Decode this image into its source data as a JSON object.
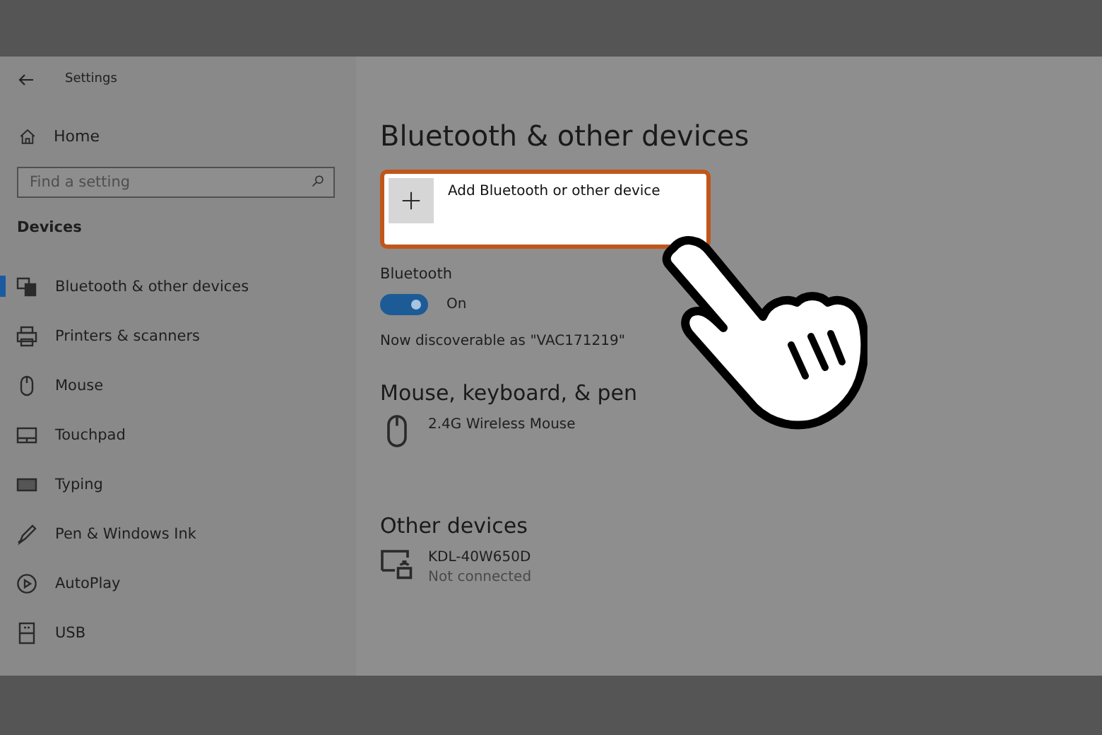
{
  "window": {
    "title": "Settings"
  },
  "sidebar": {
    "home": "Home",
    "search": {
      "placeholder": "Find a setting"
    },
    "section": "Devices",
    "items": [
      {
        "kind": "bluetooth",
        "label": "Bluetooth & other devices",
        "selected": true
      },
      {
        "kind": "printer",
        "label": "Printers & scanners",
        "selected": false
      },
      {
        "kind": "mouse",
        "label": "Mouse",
        "selected": false
      },
      {
        "kind": "touchpad",
        "label": "Touchpad",
        "selected": false
      },
      {
        "kind": "typing",
        "label": "Typing",
        "selected": false
      },
      {
        "kind": "pen",
        "label": "Pen & Windows Ink",
        "selected": false
      },
      {
        "kind": "autoplay",
        "label": "AutoPlay",
        "selected": false
      },
      {
        "kind": "usb",
        "label": "USB",
        "selected": false
      }
    ]
  },
  "main": {
    "title": "Bluetooth & other devices",
    "add_button": "Add Bluetooth or other device",
    "bluetooth": {
      "label": "Bluetooth",
      "on": true,
      "state_text": "On"
    },
    "discoverable": "Now discoverable as \"VAC171219\"",
    "sections": [
      {
        "heading": "Mouse, keyboard, & pen",
        "devices": [
          {
            "kind": "mouse",
            "name": "2.4G Wireless Mouse"
          }
        ]
      },
      {
        "heading": "Other devices",
        "devices": [
          {
            "kind": "display",
            "name": "KDL-40W650D",
            "status": "Not connected"
          }
        ]
      }
    ]
  }
}
